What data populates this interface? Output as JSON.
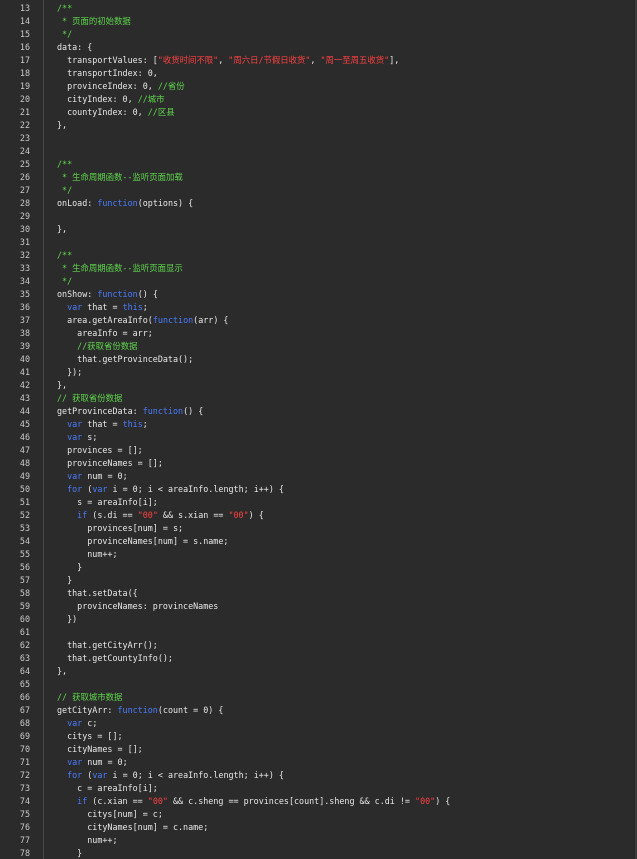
{
  "editor": {
    "lines": [
      {
        "n": "13",
        "tokens": [
          {
            "t": "/**",
            "c": "cm"
          }
        ]
      },
      {
        "n": "14",
        "tokens": [
          {
            "t": " * 页面的初始数据",
            "c": "cm"
          }
        ]
      },
      {
        "n": "15",
        "tokens": [
          {
            "t": " */",
            "c": "cm"
          }
        ]
      },
      {
        "n": "16",
        "tokens": [
          {
            "t": "data: {",
            "c": "punc"
          }
        ]
      },
      {
        "n": "17",
        "tokens": [
          {
            "t": "  transportValues: [",
            "c": "punc"
          },
          {
            "t": "\"收货时间不限\"",
            "c": "str"
          },
          {
            "t": ", ",
            "c": "punc"
          },
          {
            "t": "\"周六日/节假日收货\"",
            "c": "str"
          },
          {
            "t": ", ",
            "c": "punc"
          },
          {
            "t": "\"周一至周五收货\"",
            "c": "str"
          },
          {
            "t": "],",
            "c": "punc"
          }
        ]
      },
      {
        "n": "18",
        "tokens": [
          {
            "t": "  transportIndex: 0,",
            "c": "punc"
          }
        ]
      },
      {
        "n": "19",
        "tokens": [
          {
            "t": "  provinceIndex: 0, ",
            "c": "punc"
          },
          {
            "t": "//省份",
            "c": "cm"
          }
        ]
      },
      {
        "n": "20",
        "tokens": [
          {
            "t": "  cityIndex: 0, ",
            "c": "punc"
          },
          {
            "t": "//城市",
            "c": "cm"
          }
        ]
      },
      {
        "n": "21",
        "tokens": [
          {
            "t": "  countyIndex: 0, ",
            "c": "punc"
          },
          {
            "t": "//区县",
            "c": "cm"
          }
        ]
      },
      {
        "n": "22",
        "tokens": [
          {
            "t": "},",
            "c": "punc"
          }
        ]
      },
      {
        "n": "23",
        "tokens": []
      },
      {
        "n": "24",
        "tokens": []
      },
      {
        "n": "25",
        "tokens": [
          {
            "t": "/**",
            "c": "cm"
          }
        ]
      },
      {
        "n": "26",
        "tokens": [
          {
            "t": " * 生命周期函数--监听页面加载",
            "c": "cm"
          }
        ]
      },
      {
        "n": "27",
        "tokens": [
          {
            "t": " */",
            "c": "cm"
          }
        ]
      },
      {
        "n": "28",
        "tokens": [
          {
            "t": "onLoad: ",
            "c": "punc"
          },
          {
            "t": "function",
            "c": "kw"
          },
          {
            "t": "(options) {",
            "c": "punc"
          }
        ]
      },
      {
        "n": "29",
        "tokens": []
      },
      {
        "n": "30",
        "tokens": [
          {
            "t": "},",
            "c": "punc"
          }
        ]
      },
      {
        "n": "31",
        "tokens": []
      },
      {
        "n": "32",
        "tokens": [
          {
            "t": "/**",
            "c": "cm"
          }
        ]
      },
      {
        "n": "33",
        "tokens": [
          {
            "t": " * 生命周期函数--监听页面显示",
            "c": "cm"
          }
        ]
      },
      {
        "n": "34",
        "tokens": [
          {
            "t": " */",
            "c": "cm"
          }
        ]
      },
      {
        "n": "35",
        "tokens": [
          {
            "t": "onShow: ",
            "c": "punc"
          },
          {
            "t": "function",
            "c": "kw"
          },
          {
            "t": "() {",
            "c": "punc"
          }
        ]
      },
      {
        "n": "36",
        "tokens": [
          {
            "t": "  ",
            "c": "punc"
          },
          {
            "t": "var",
            "c": "kw"
          },
          {
            "t": " that = ",
            "c": "punc"
          },
          {
            "t": "this",
            "c": "kw"
          },
          {
            "t": ";",
            "c": "punc"
          }
        ]
      },
      {
        "n": "37",
        "tokens": [
          {
            "t": "  area.getAreaInfo(",
            "c": "punc"
          },
          {
            "t": "function",
            "c": "kw"
          },
          {
            "t": "(arr) {",
            "c": "punc"
          }
        ]
      },
      {
        "n": "38",
        "tokens": [
          {
            "t": "    areaInfo = arr;",
            "c": "punc"
          }
        ]
      },
      {
        "n": "39",
        "tokens": [
          {
            "t": "    ",
            "c": "punc"
          },
          {
            "t": "//获取省份数据",
            "c": "cm"
          }
        ]
      },
      {
        "n": "40",
        "tokens": [
          {
            "t": "    that.getProvinceData();",
            "c": "punc"
          }
        ]
      },
      {
        "n": "41",
        "tokens": [
          {
            "t": "  });",
            "c": "punc"
          }
        ]
      },
      {
        "n": "42",
        "tokens": [
          {
            "t": "},",
            "c": "punc"
          }
        ]
      },
      {
        "n": "43",
        "tokens": [
          {
            "t": "// 获取省份数据",
            "c": "cm"
          }
        ]
      },
      {
        "n": "44",
        "tokens": [
          {
            "t": "getProvinceData: ",
            "c": "punc"
          },
          {
            "t": "function",
            "c": "kw"
          },
          {
            "t": "() {",
            "c": "punc"
          }
        ]
      },
      {
        "n": "45",
        "tokens": [
          {
            "t": "  ",
            "c": "punc"
          },
          {
            "t": "var",
            "c": "kw"
          },
          {
            "t": " that = ",
            "c": "punc"
          },
          {
            "t": "this",
            "c": "kw"
          },
          {
            "t": ";",
            "c": "punc"
          }
        ]
      },
      {
        "n": "46",
        "tokens": [
          {
            "t": "  ",
            "c": "punc"
          },
          {
            "t": "var",
            "c": "kw"
          },
          {
            "t": " s;",
            "c": "punc"
          }
        ]
      },
      {
        "n": "47",
        "tokens": [
          {
            "t": "  provinces = [];",
            "c": "punc"
          }
        ]
      },
      {
        "n": "48",
        "tokens": [
          {
            "t": "  provinceNames = [];",
            "c": "punc"
          }
        ]
      },
      {
        "n": "49",
        "tokens": [
          {
            "t": "  ",
            "c": "punc"
          },
          {
            "t": "var",
            "c": "kw"
          },
          {
            "t": " num = 0;",
            "c": "punc"
          }
        ]
      },
      {
        "n": "50",
        "tokens": [
          {
            "t": "  ",
            "c": "punc"
          },
          {
            "t": "for",
            "c": "kw"
          },
          {
            "t": " (",
            "c": "punc"
          },
          {
            "t": "var",
            "c": "kw"
          },
          {
            "t": " i = 0; i < areaInfo.length; i++) {",
            "c": "punc"
          }
        ]
      },
      {
        "n": "51",
        "tokens": [
          {
            "t": "    s = areaInfo[i];",
            "c": "punc"
          }
        ]
      },
      {
        "n": "52",
        "tokens": [
          {
            "t": "    ",
            "c": "punc"
          },
          {
            "t": "if",
            "c": "kw"
          },
          {
            "t": " (s.di == ",
            "c": "punc"
          },
          {
            "t": "\"00\"",
            "c": "str"
          },
          {
            "t": " && s.xian == ",
            "c": "punc"
          },
          {
            "t": "\"00\"",
            "c": "str"
          },
          {
            "t": ") {",
            "c": "punc"
          }
        ]
      },
      {
        "n": "53",
        "tokens": [
          {
            "t": "      provinces[num] = s;",
            "c": "punc"
          }
        ]
      },
      {
        "n": "54",
        "tokens": [
          {
            "t": "      provinceNames[num] = s.name;",
            "c": "punc"
          }
        ]
      },
      {
        "n": "55",
        "tokens": [
          {
            "t": "      num++;",
            "c": "punc"
          }
        ]
      },
      {
        "n": "56",
        "tokens": [
          {
            "t": "    }",
            "c": "punc"
          }
        ]
      },
      {
        "n": "57",
        "tokens": [
          {
            "t": "  }",
            "c": "punc"
          }
        ]
      },
      {
        "n": "58",
        "tokens": [
          {
            "t": "  that.setData({",
            "c": "punc"
          }
        ]
      },
      {
        "n": "59",
        "tokens": [
          {
            "t": "    provinceNames: provinceNames",
            "c": "punc"
          }
        ]
      },
      {
        "n": "60",
        "tokens": [
          {
            "t": "  })",
            "c": "punc"
          }
        ]
      },
      {
        "n": "61",
        "tokens": []
      },
      {
        "n": "62",
        "tokens": [
          {
            "t": "  that.getCityArr();",
            "c": "punc"
          }
        ]
      },
      {
        "n": "63",
        "tokens": [
          {
            "t": "  that.getCountyInfo();",
            "c": "punc"
          }
        ]
      },
      {
        "n": "64",
        "tokens": [
          {
            "t": "},",
            "c": "punc"
          }
        ]
      },
      {
        "n": "65",
        "tokens": []
      },
      {
        "n": "66",
        "tokens": [
          {
            "t": "// 获取城市数据",
            "c": "cm"
          }
        ]
      },
      {
        "n": "67",
        "tokens": [
          {
            "t": "getCityArr: ",
            "c": "punc"
          },
          {
            "t": "function",
            "c": "kw"
          },
          {
            "t": "(count = 0) {",
            "c": "punc"
          }
        ]
      },
      {
        "n": "68",
        "tokens": [
          {
            "t": "  ",
            "c": "punc"
          },
          {
            "t": "var",
            "c": "kw"
          },
          {
            "t": " c;",
            "c": "punc"
          }
        ]
      },
      {
        "n": "69",
        "tokens": [
          {
            "t": "  citys = [];",
            "c": "punc"
          }
        ]
      },
      {
        "n": "70",
        "tokens": [
          {
            "t": "  cityNames = [];",
            "c": "punc"
          }
        ]
      },
      {
        "n": "71",
        "tokens": [
          {
            "t": "  ",
            "c": "punc"
          },
          {
            "t": "var",
            "c": "kw"
          },
          {
            "t": " num = 0;",
            "c": "punc"
          }
        ]
      },
      {
        "n": "72",
        "tokens": [
          {
            "t": "  ",
            "c": "punc"
          },
          {
            "t": "for",
            "c": "kw"
          },
          {
            "t": " (",
            "c": "punc"
          },
          {
            "t": "var",
            "c": "kw"
          },
          {
            "t": " i = 0; i < areaInfo.length; i++) {",
            "c": "punc"
          }
        ]
      },
      {
        "n": "73",
        "tokens": [
          {
            "t": "    c = areaInfo[i];",
            "c": "punc"
          }
        ]
      },
      {
        "n": "74",
        "tokens": [
          {
            "t": "    ",
            "c": "punc"
          },
          {
            "t": "if",
            "c": "kw"
          },
          {
            "t": " (c.xian == ",
            "c": "punc"
          },
          {
            "t": "\"00\"",
            "c": "str"
          },
          {
            "t": " && c.sheng == provinces[count].sheng && c.di != ",
            "c": "punc"
          },
          {
            "t": "\"00\"",
            "c": "str"
          },
          {
            "t": ") {",
            "c": "punc"
          }
        ]
      },
      {
        "n": "75",
        "tokens": [
          {
            "t": "      citys[num] = c;",
            "c": "punc"
          }
        ]
      },
      {
        "n": "76",
        "tokens": [
          {
            "t": "      cityNames[num] = c.name;",
            "c": "punc"
          }
        ]
      },
      {
        "n": "77",
        "tokens": [
          {
            "t": "      num++;",
            "c": "punc"
          }
        ]
      },
      {
        "n": "78",
        "tokens": [
          {
            "t": "    }",
            "c": "punc"
          }
        ]
      }
    ]
  }
}
